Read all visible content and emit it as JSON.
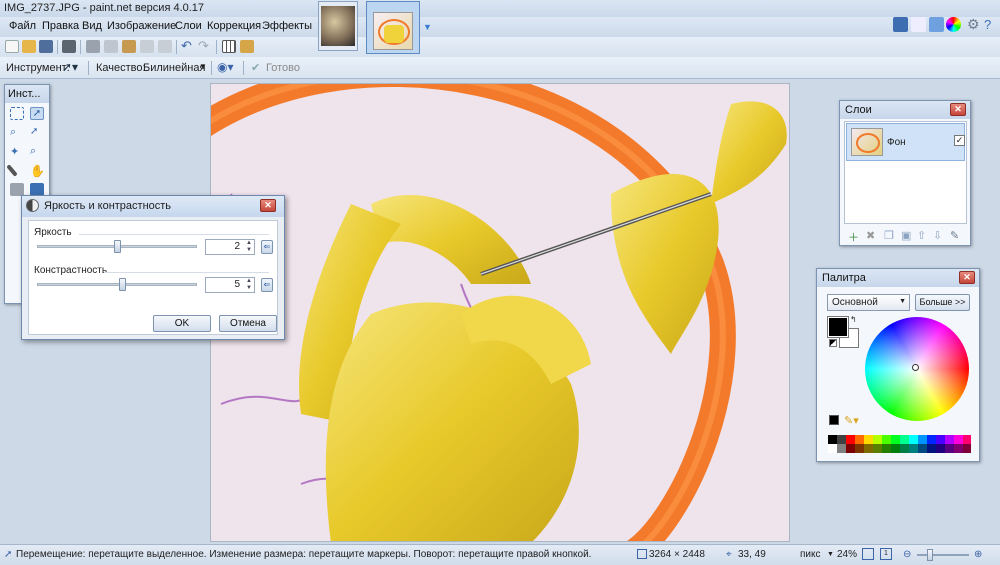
{
  "window": {
    "title": "IMG_2737.JPG - paint.net версия 4.0.17"
  },
  "menu": [
    "Файл",
    "Правка",
    "Вид",
    "Изображение",
    "Слои",
    "Коррекция",
    "Эффекты"
  ],
  "toolbar2": {
    "tool_label": "Инструмент:",
    "quality_label": "Качество:",
    "quality_value": "Билинейная",
    "done_label": "Готово"
  },
  "tools_panel": {
    "title": "Инст..."
  },
  "dialog": {
    "title": "Яркость и контрастность",
    "brightness_label": "Яркость",
    "brightness_value": "2",
    "brightness_level": 0.5,
    "contrast_label": "Констрастность",
    "contrast_value": "5",
    "contrast_level": 0.53,
    "ok_label": "OK",
    "cancel_label": "Отмена"
  },
  "layers_panel": {
    "title": "Слои",
    "layers": [
      {
        "name": "Фон",
        "checked": "✓"
      }
    ]
  },
  "palette_panel": {
    "title": "Палитра",
    "mode": "Основной",
    "more_label": "Больше >>"
  },
  "status": {
    "hint": "Перемещение: перетащите выделенное. Изменение размера: перетащите маркеры. Поворот: перетащите правой кнопкой.",
    "image_size": "3264 × 2448",
    "cursor": "33, 49",
    "unit": "пикс",
    "zoom": "24%"
  },
  "colors": {
    "accent": "#3a7bd5",
    "ribbon_yellow": "#f0d23a",
    "hoop_orange": "#f2782a",
    "primary_color": "#000000",
    "secondary_color": "#ffffff"
  }
}
